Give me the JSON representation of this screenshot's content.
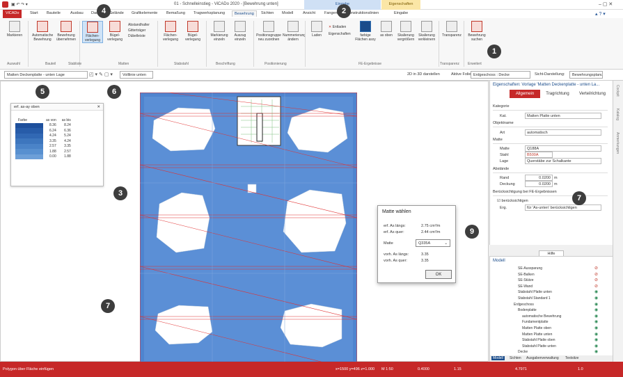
{
  "window": {
    "title": "01 - Schnelleinstieg - ViCADo 2020 - [Bewehrung unten]",
    "ctx_tab_eingabe": "Eingabe",
    "ctx_tab_eigenschaften": "Eigenschaften"
  },
  "tabs": [
    "ViCADo",
    "Start",
    "Bauteile",
    "Ausbau",
    "Dach",
    "Gelände",
    "Grafikelemente",
    "Bemaßung",
    "Tragwerksplanung",
    "Bewehrung",
    "Sichten",
    "Modell",
    "Ansicht",
    "Fangen",
    "Konstruktionslinien",
    "Eingabe"
  ],
  "ribbon": {
    "buttons": [
      {
        "label": "Markieren"
      },
      {
        "label": "Automatische Bewehrung"
      },
      {
        "label": "Bewehrung übernehmen"
      },
      {
        "label": "Flächen-verlegung"
      },
      {
        "label": "Bügel-verlegung"
      },
      {
        "label": "Flächen-verlegung"
      },
      {
        "label": "Bügel-verlegung"
      },
      {
        "label": "Markierung einzeln"
      },
      {
        "label": "Auszug einzeln"
      },
      {
        "label": "Positionsgruppe neu zuordnen"
      },
      {
        "label": "Nummerierung ändern"
      },
      {
        "label": "Laden"
      },
      {
        "label": "Entladen"
      },
      {
        "label": "Eigenschaften"
      },
      {
        "label": "farbige Flächen asxy"
      },
      {
        "label": "as oben"
      },
      {
        "label": "Skalierung vergrößern"
      },
      {
        "label": "Skalierung verkleinern"
      },
      {
        "label": "Transparenz"
      },
      {
        "label": "Bewehrung suchen"
      }
    ],
    "small_items": [
      "Abstandhalter",
      "Gitterträger",
      "Dübelleiste"
    ],
    "groups": [
      "Auswahl",
      "Bauteil",
      "Stabliste",
      "Matten",
      "Stabstahl",
      "Beschriftung",
      "Positionierung",
      "FE-Ergebnisse",
      "Transparenz",
      "Erweitert"
    ]
  },
  "toolbar": {
    "view_select": "Matten Deckenplatte - unten Lage",
    "hatch_select": "Volllinie unten",
    "show3d": "2D in 3D darstellen",
    "active_folie_label": "Aktive Folie:",
    "active_folie": "Erdgeschoss : Decke",
    "sicht_label": "Sicht-Darstellung:",
    "sicht_value": "Bewehrungsplanung"
  },
  "legend": {
    "title": "erf. as-ay oben",
    "headers": [
      "Farbe",
      "as von",
      "as bis"
    ],
    "rows": [
      {
        "from": "8.36",
        "to": "8.24",
        "color": "#1d4f9c"
      },
      {
        "from": "6.24",
        "to": "6.36",
        "color": "#275ca9"
      },
      {
        "from": "4.24",
        "to": "5.24",
        "color": "#3168b4"
      },
      {
        "from": "3.35",
        "to": "4.24",
        "color": "#3d76be"
      },
      {
        "from": "2.57",
        "to": "3.35",
        "color": "#4a83c8"
      },
      {
        "from": "1.88",
        "to": "2.57",
        "color": "#5890d0"
      },
      {
        "from": "0.00",
        "to": "1.88",
        "color": "#6d9fd8"
      }
    ]
  },
  "dialog": {
    "title": "Matte wählen",
    "erf_long_label": "erf. As längs:",
    "erf_long_value": "2.75 cm²/m",
    "erf_quer_label": "erf. As quer:",
    "erf_quer_value": "2.44 cm²/m",
    "matte_label": "Matte",
    "matte_value": "Q335A",
    "vorh_long_label": "vorh. As längs:",
    "vorh_long_value": "3.35",
    "vorh_quer_label": "vorh. As quer:",
    "vorh_quer_value": "3.35",
    "ok": "OK"
  },
  "props": {
    "header": "Eigenschaften: Vorlage 'Matten Deckenplatte - unten La...",
    "tabs": [
      "Allgemein",
      "Tragrichtung",
      "Verteilrichtung"
    ],
    "kategorie": "Kategorie",
    "kat_label": "Kat.",
    "kat_value": "Matten Platte unten",
    "objektname": "Objektname",
    "art_label": "Art",
    "art_value": "automatisch",
    "matte_section": "Matte",
    "matte_label": "Matte",
    "matte_value": "Q188A",
    "stahl_label": "Stahl",
    "stahl_value": "B500A",
    "lage_label": "Lage",
    "lage_value": "Querstäbe zur Schalkante",
    "abstaende": "Abstände",
    "rand_label": "Rand",
    "rand_value": "0.0200",
    "rand_unit": "m",
    "deckung_label": "Deckung",
    "deckung_value": "0.0200",
    "deckung_unit": "m",
    "fe_section": "Berücksichtigung bei FE-Ergebnissen",
    "fe_check": "berücksichtigen",
    "erg_label": "Erg.",
    "erg_value": "für 'As-unten' berücksichtigen",
    "help": "Hilfe"
  },
  "tree": {
    "header": "Modell",
    "items": [
      "SE-Aussparung",
      "SE-Balken",
      "SE-Stütze",
      "SE-Wand",
      "Stabstahl Platte unten",
      "Stabstahl Standard 1",
      "Erdgeschoss",
      "Bodenplatte",
      "automatische Bewehrung",
      "Fundamentplatte",
      "Matten Platte oben",
      "Matten Platte unten",
      "Stabstahl Platte oben",
      "Stabstahl Platte unten",
      "Decke"
    ],
    "bottom_tabs": [
      "Modell",
      "Sichten",
      "Ausgabenverwaltung",
      "Textsitze"
    ]
  },
  "rail": [
    "Cockpit",
    "Katalog",
    "Anmerkungen"
  ],
  "status": {
    "left": "Polygon über Fläche einfügen",
    "coords": "x=1500 y=496 z=1.000",
    "scale": "M 1:50",
    "n1": "0.4000",
    "n2": "1.15",
    "n3": "4.7971",
    "n4": "1.0"
  },
  "callouts": [
    "1",
    "2",
    "3",
    "4",
    "5",
    "6",
    "7",
    "7",
    "9"
  ]
}
